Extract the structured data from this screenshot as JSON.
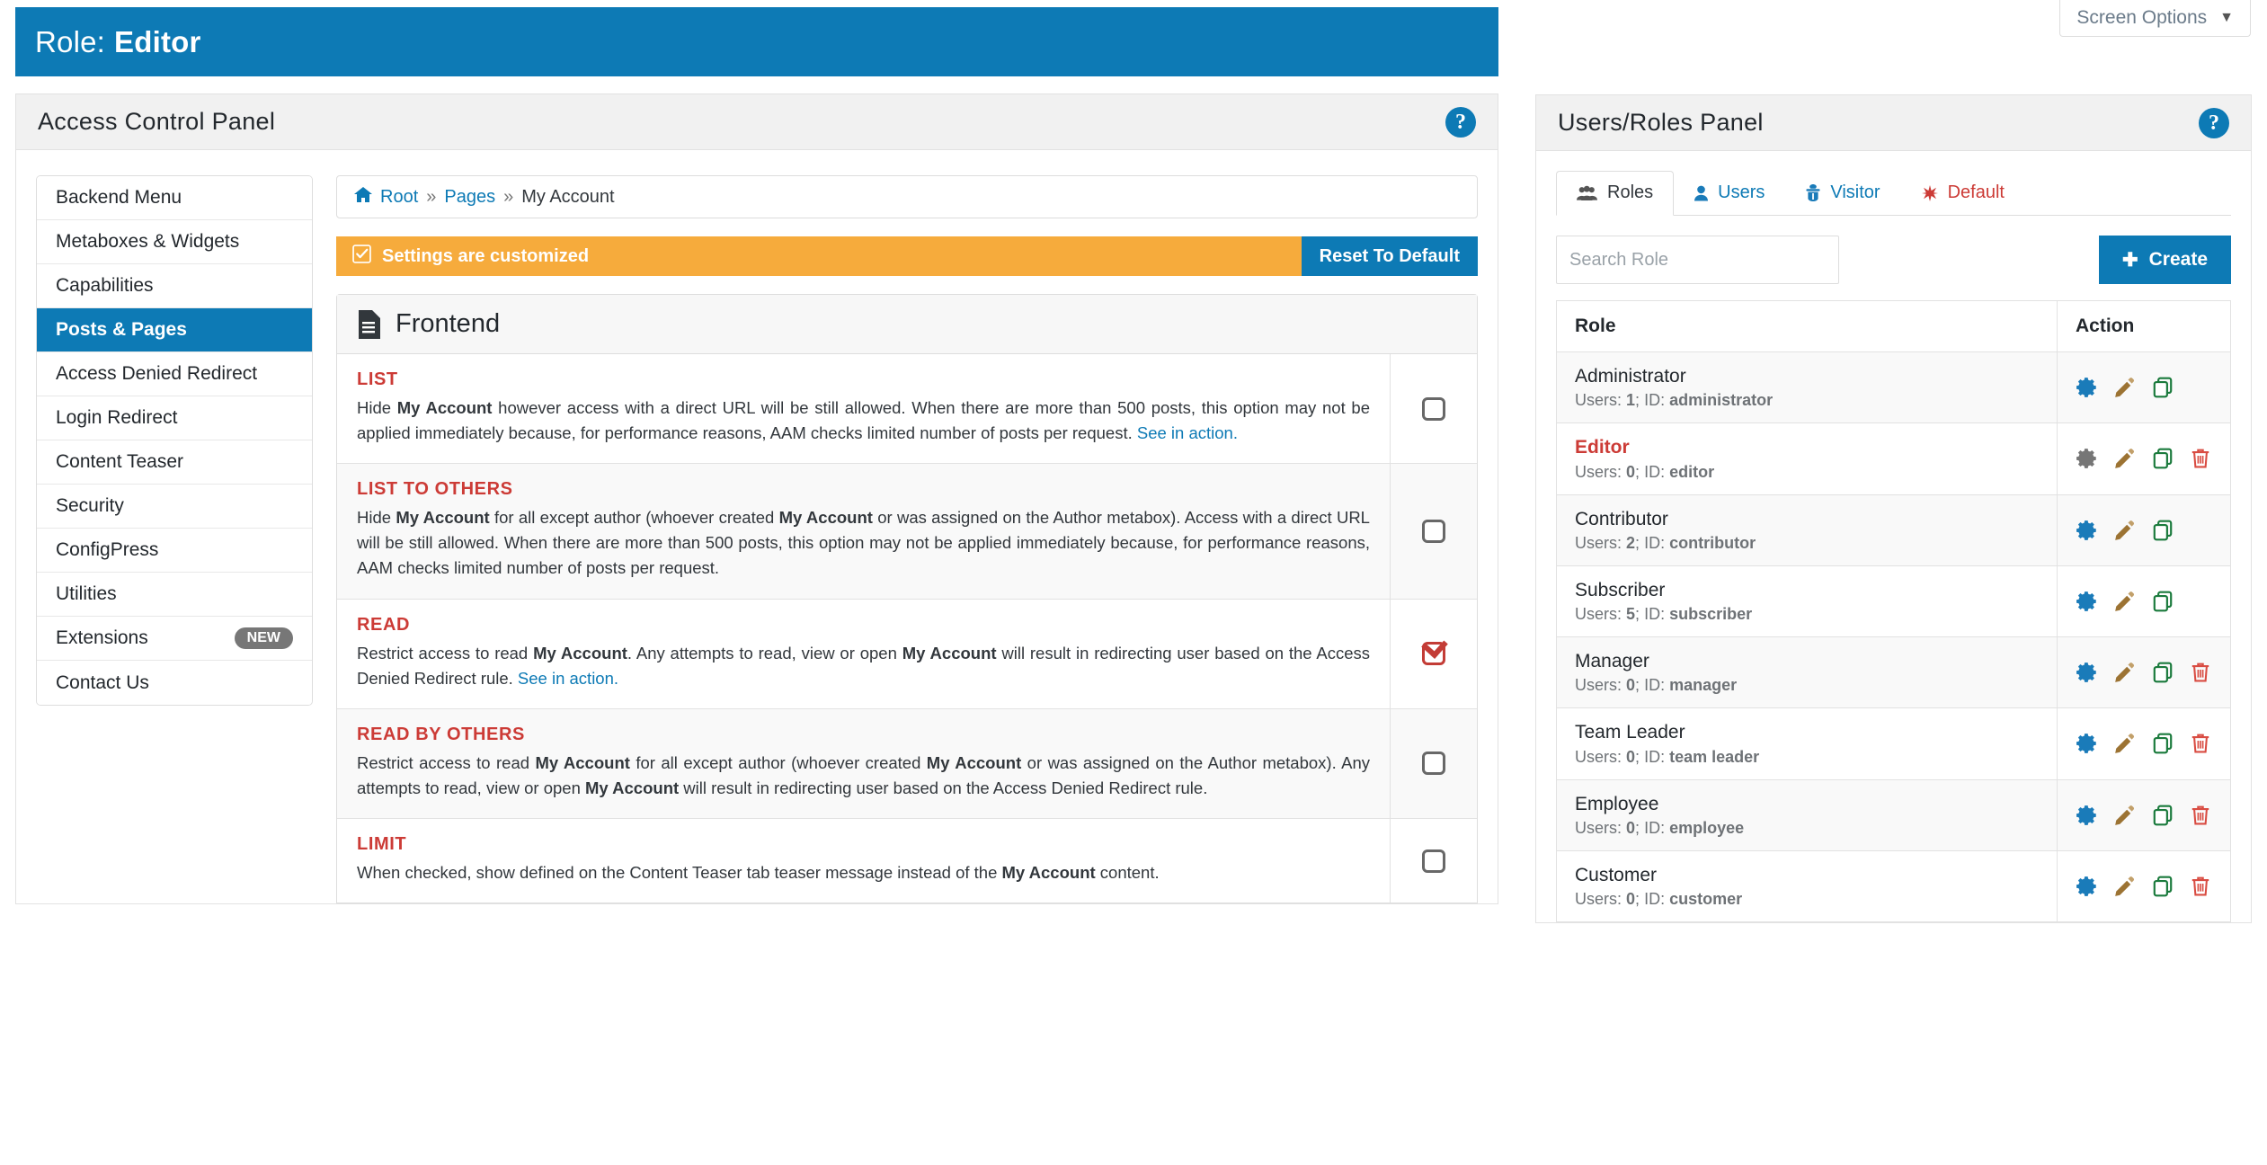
{
  "screen_options": {
    "label": "Screen Options",
    "caret": "chevron-down-icon"
  },
  "role_bar": {
    "label": "Role:",
    "value": "Editor"
  },
  "access_control_panel": {
    "title": "Access Control Panel",
    "help": "?",
    "sidebar": [
      {
        "label": "Backend Menu",
        "active": false
      },
      {
        "label": "Metaboxes & Widgets",
        "active": false
      },
      {
        "label": "Capabilities",
        "active": false
      },
      {
        "label": "Posts & Pages",
        "active": true
      },
      {
        "label": "Access Denied Redirect",
        "active": false
      },
      {
        "label": "Login Redirect",
        "active": false
      },
      {
        "label": "Content Teaser",
        "active": false
      },
      {
        "label": "Security",
        "active": false
      },
      {
        "label": "ConfigPress",
        "active": false
      },
      {
        "label": "Utilities",
        "active": false
      },
      {
        "label": "Extensions",
        "active": false,
        "badge": "NEW"
      },
      {
        "label": "Contact Us",
        "active": false
      }
    ],
    "breadcrumb": {
      "home_icon": "home-icon",
      "root": "Root",
      "sep1": "»",
      "pages": "Pages",
      "sep2": "»",
      "current": "My Account"
    },
    "notice": {
      "icon": "check-square-icon",
      "message": "Settings are customized",
      "button": "Reset To Default"
    },
    "frontend": {
      "icon": "document-icon",
      "title": "Frontend",
      "options": [
        {
          "title": "LIST",
          "checked": false,
          "parts": [
            {
              "t": "Hide "
            },
            {
              "t": "My Account",
              "b": true
            },
            {
              "t": " however access with a direct URL will be still allowed. When there are more than 500 posts, this option may not be applied immediately because, for performance reasons, AAM checks limited number of posts per request. "
            },
            {
              "t": "See in action.",
              "link": true
            }
          ]
        },
        {
          "title": "LIST TO OTHERS",
          "checked": false,
          "parts": [
            {
              "t": "Hide "
            },
            {
              "t": "My Account",
              "b": true
            },
            {
              "t": " for all except author (whoever created "
            },
            {
              "t": "My Account",
              "b": true
            },
            {
              "t": " or was assigned on the Author metabox). Access with a direct URL will be still allowed. When there are more than 500 posts, this option may not be applied immediately because, for performance reasons, AAM checks limited number of posts per request."
            }
          ]
        },
        {
          "title": "READ",
          "checked": true,
          "parts": [
            {
              "t": "Restrict access to read "
            },
            {
              "t": "My Account",
              "b": true
            },
            {
              "t": ". Any attempts to read, view or open "
            },
            {
              "t": "My Account",
              "b": true
            },
            {
              "t": " will result in redirecting user based on the Access Denied Redirect rule. "
            },
            {
              "t": "See in action.",
              "link": true
            }
          ]
        },
        {
          "title": "READ BY OTHERS",
          "checked": false,
          "parts": [
            {
              "t": "Restrict access to read "
            },
            {
              "t": "My Account",
              "b": true
            },
            {
              "t": " for all except author (whoever created "
            },
            {
              "t": "My Account",
              "b": true
            },
            {
              "t": " or was assigned on the Author metabox). Any attempts to read, view or open "
            },
            {
              "t": "My Account",
              "b": true
            },
            {
              "t": " will result in redirecting user based on the Access Denied Redirect rule."
            }
          ]
        },
        {
          "title": "LIMIT",
          "checked": false,
          "parts": [
            {
              "t": "When checked, show defined on the Content Teaser tab teaser message instead of the "
            },
            {
              "t": "My Account",
              "b": true
            },
            {
              "t": " content."
            }
          ]
        }
      ]
    }
  },
  "users_roles_panel": {
    "title": "Users/Roles Panel",
    "help": "?",
    "tabs": [
      {
        "label": "Roles",
        "icon": "users-group-icon",
        "active": true
      },
      {
        "label": "Users",
        "icon": "user-icon",
        "active": false
      },
      {
        "label": "Visitor",
        "icon": "spy-icon",
        "active": false
      },
      {
        "label": "Default",
        "icon": "asterisk-icon",
        "active": false,
        "danger": true
      }
    ],
    "search": {
      "placeholder": "Search Role",
      "value": ""
    },
    "create_button": {
      "icon": "plus-icon",
      "label": "Create"
    },
    "table": {
      "columns": [
        "Role",
        "Action"
      ],
      "rows": [
        {
          "name": "Administrator",
          "meta_users_label": "Users:",
          "users": "1",
          "meta_id_label": "ID:",
          "id": "administrator",
          "selected": false,
          "actions": [
            "gear-icon",
            "pencil-icon",
            "copy-icon"
          ]
        },
        {
          "name": "Editor",
          "meta_users_label": "Users:",
          "users": "0",
          "meta_id_label": "ID:",
          "id": "editor",
          "selected": true,
          "actions": [
            "gear-icon",
            "pencil-icon",
            "copy-icon",
            "trash-icon"
          ]
        },
        {
          "name": "Contributor",
          "meta_users_label": "Users:",
          "users": "2",
          "meta_id_label": "ID:",
          "id": "contributor",
          "selected": false,
          "actions": [
            "gear-icon",
            "pencil-icon",
            "copy-icon"
          ]
        },
        {
          "name": "Subscriber",
          "meta_users_label": "Users:",
          "users": "5",
          "meta_id_label": "ID:",
          "id": "subscriber",
          "selected": false,
          "actions": [
            "gear-icon",
            "pencil-icon",
            "copy-icon"
          ]
        },
        {
          "name": "Manager",
          "meta_users_label": "Users:",
          "users": "0",
          "meta_id_label": "ID:",
          "id": "manager",
          "selected": false,
          "actions": [
            "gear-icon",
            "pencil-icon",
            "copy-icon",
            "trash-icon"
          ]
        },
        {
          "name": "Team Leader",
          "meta_users_label": "Users:",
          "users": "0",
          "meta_id_label": "ID:",
          "id": "team leader",
          "selected": false,
          "actions": [
            "gear-icon",
            "pencil-icon",
            "copy-icon",
            "trash-icon"
          ]
        },
        {
          "name": "Employee",
          "meta_users_label": "Users:",
          "users": "0",
          "meta_id_label": "ID:",
          "id": "employee",
          "selected": false,
          "actions": [
            "gear-icon",
            "pencil-icon",
            "copy-icon",
            "trash-icon"
          ]
        },
        {
          "name": "Customer",
          "meta_users_label": "Users:",
          "users": "0",
          "meta_id_label": "ID:",
          "id": "customer",
          "selected": false,
          "actions": [
            "gear-icon",
            "pencil-icon",
            "copy-icon",
            "trash-icon"
          ]
        }
      ]
    }
  },
  "colors": {
    "brand_blue": "#0d7ab5",
    "notice_orange": "#f6ab3c",
    "danger_red": "#cc3b36",
    "gear_blue": "#1a7bb9",
    "gear_gray": "#767676",
    "pencil_brown": "#9c7333",
    "copy_green": "#1a7a3c",
    "trash_red": "#d94c42"
  }
}
